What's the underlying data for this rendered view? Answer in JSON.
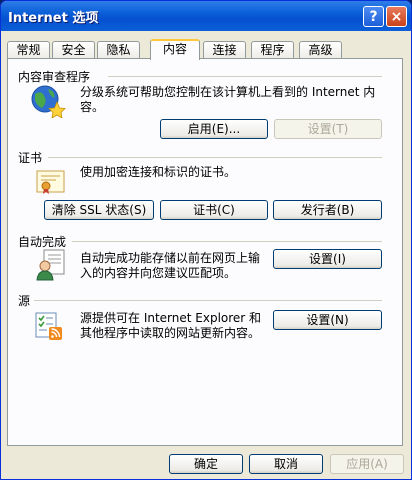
{
  "window": {
    "title": "Internet 选项"
  },
  "titlebar": {
    "help_label": "?",
    "close_label": "×"
  },
  "tabs": [
    {
      "label": "常规"
    },
    {
      "label": "安全"
    },
    {
      "label": "隐私"
    },
    {
      "label": "内容",
      "active": true
    },
    {
      "label": "连接"
    },
    {
      "label": "程序"
    },
    {
      "label": "高级"
    }
  ],
  "content_advisor": {
    "title": "内容审查程序",
    "description": "分级系统可帮助您控制在该计算机上看到的 Internet 内容。",
    "enable_label": "启用(E)...",
    "settings_label": "设置(T)"
  },
  "certificates": {
    "title": "证书",
    "description": "使用加密连接和标识的证书。",
    "clear_ssl_label": "清除 SSL 状态(S)",
    "certificates_label": "证书(C)",
    "publishers_label": "发行者(B)"
  },
  "autocomplete": {
    "title": "自动完成",
    "description": "自动完成功能存储以前在网页上输入的内容并向您建议匹配项。",
    "settings_label": "设置(I)"
  },
  "feeds": {
    "title": "源",
    "description": "源提供可在 Internet Explorer 和其他程序中读取的网站更新内容。",
    "settings_label": "设置(N)"
  },
  "footer": {
    "ok_label": "确定",
    "cancel_label": "取消",
    "apply_label": "应用(A)"
  }
}
